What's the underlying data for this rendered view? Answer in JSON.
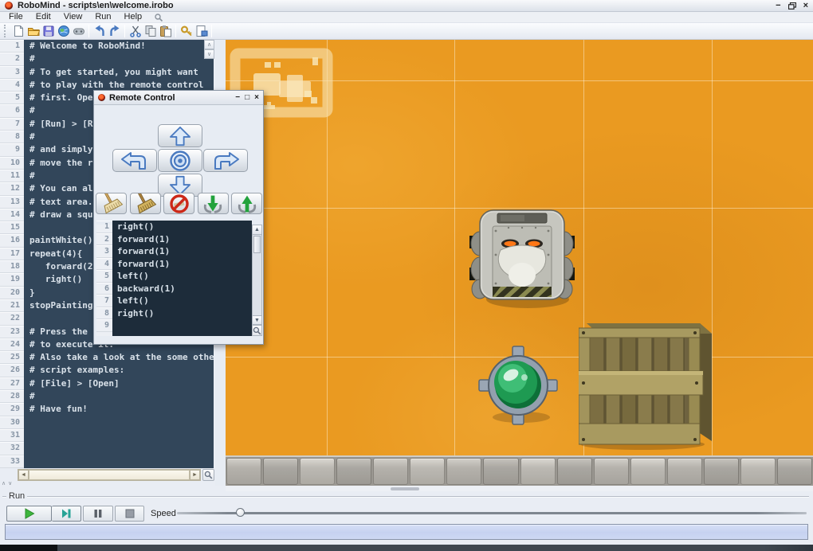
{
  "window": {
    "title": "RoboMind - scripts\\en\\welcome.irobo",
    "controls": [
      "minimize",
      "restore",
      "close"
    ]
  },
  "menu": {
    "items": [
      "File",
      "Edit",
      "View",
      "Run",
      "Help"
    ],
    "search_icon": "search-icon"
  },
  "toolbar": {
    "groups": [
      [
        "new-file",
        "open-file",
        "save-file",
        "open-map",
        "remote-control"
      ],
      [
        "undo",
        "redo"
      ],
      [
        "cut",
        "copy",
        "paste"
      ],
      [
        "find",
        "insert-template"
      ]
    ]
  },
  "editor": {
    "lines": [
      "# Welcome to RoboMind!",
      "#",
      "# To get started, you might want",
      "# to play with the remote control",
      "# first. Open it at",
      "#",
      "# [Run] > [Remote control]",
      "#",
      "# and simply",
      "# move the robot",
      "#",
      "# You can also type scripts in the",
      "# text area. The script below will",
      "# draw a square",
      "",
      "paintWhite()",
      "repeat(4){",
      "   forward(2)",
      "   right()",
      "}",
      "stopPainting()",
      "",
      "# Press the green play button",
      "# to execute it.",
      "# Also take a look at the some other",
      "# script examples:",
      "# [File] > [Open]",
      "#",
      "# Have fun!",
      "",
      "",
      "",
      ""
    ]
  },
  "remote_control": {
    "title": "Remote Control",
    "controls": [
      "minimize",
      "maximize",
      "close"
    ],
    "dpad": [
      "arrow-up",
      "turn-left",
      "target",
      "turn-right",
      "arrow-down"
    ],
    "actions": [
      "paint-white",
      "paint-black",
      "stop-painting",
      "pick-up",
      "put-down"
    ],
    "history": [
      "right()",
      "forward(1)",
      "forward(1)",
      "forward(1)",
      "left()",
      "backward(1)",
      "left()",
      "right()",
      ""
    ]
  },
  "map": {
    "objects": [
      "minimap-overlay",
      "robot",
      "beacon",
      "crate",
      "wall"
    ]
  },
  "run_panel": {
    "label": "Run",
    "speed_label": "Speed",
    "buttons": [
      "play",
      "step",
      "pause",
      "stop"
    ],
    "speed_value_percent": 10
  },
  "colors": {
    "floor": "#EA9A21",
    "editor_bg": "#32465A",
    "history_bg": "#1D2C3A",
    "accent_blue": "#4A7AC0",
    "beacon_green": "#2FAE62",
    "progress_fill": "#CBD7F2"
  }
}
